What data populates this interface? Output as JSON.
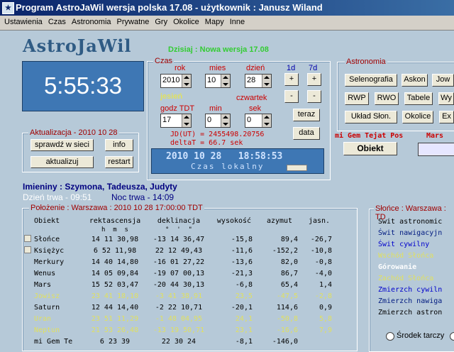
{
  "window": {
    "title": "Program AstroJaWil wersja polska 17.08 - użytkownik : Janusz Wiland",
    "icon": "app-icon"
  },
  "menu": [
    "Ustawienia",
    "Czas",
    "Astronomia",
    "Prywatne",
    "Gry",
    "Okolice",
    "Mapy",
    "Inne"
  ],
  "logo": "AstroJaWil",
  "news": "Dzisiaj : Nowa wersja 17.08",
  "clock": "5:55:33",
  "czas": {
    "label": "Czas",
    "rok_label": "rok",
    "mies_label": "mies",
    "dzien_label": "dzień",
    "d1_label": "1d",
    "d7_label": "7d",
    "rok": "2010",
    "mies": "10",
    "dzien": "28",
    "plus": "+",
    "minus": "-",
    "jesien": "jesień",
    "czwartek": "czwartek",
    "godz_label": "godz TDT",
    "min_label": "min",
    "sek_label": "sek",
    "godz": "17",
    "min": "0",
    "sek": "0",
    "teraz": "teraz",
    "data": "data",
    "jd": "JD(UT) = 2455498.20756",
    "deltat": "deltaT = 66.7 sek",
    "lcd_line1": "2010 10 28   18:58:53",
    "lcd_line2": "Czas lokalny"
  },
  "aktualizacja": {
    "label": "Aktualizacja - 2010 10 28",
    "sprawdz": "sprawdź w sieci",
    "info": "info",
    "aktualizuj": "aktualizuj",
    "restart": "restart"
  },
  "astronomia": {
    "label": "Astronomia",
    "buttons": [
      "Selenografia",
      "Askon",
      "Jow",
      "RWP",
      "RWO",
      "Tabele",
      "Wy",
      "Układ Słon.",
      "Okolice",
      "Ex"
    ]
  },
  "obiekt": {
    "header": "mi Gem Tejat Pos",
    "mars": "Mars",
    "button": "Obiekt"
  },
  "imieniny": "Imieniny : Szymona, Tadeusza, Judyty",
  "dzien_trwa": "Dzień trwa - 09:51",
  "noc_trwa": "Noc trwa - 14:09",
  "polozenie": {
    "label": "Położenie : Warszawa : 2010 10 28  17:00:00 TDT",
    "headers": [
      "Obiekt",
      "rektascensja",
      "deklinacja",
      "wysokość",
      "azymut",
      "jasn."
    ],
    "subheaders": [
      "h",
      "m",
      "s",
      "°",
      "'",
      "\""
    ],
    "rows": [
      {
        "name": "Słońce",
        "ra": "14 11 30,98",
        "dec": "-13 14 36,47",
        "alt": "-15,8",
        "az": "89,4",
        "mag": "-26,7",
        "color": "#000000",
        "check": true
      },
      {
        "name": "Księżyc",
        "ra": "6 52 11,98",
        "dec": "22 12 49,43",
        "alt": "-11,6",
        "az": "-152,2",
        "mag": "-10,8",
        "color": "#000000",
        "check": true
      },
      {
        "name": "Merkury",
        "ra": "14 40 14,80",
        "dec": "-16 01 27,22",
        "alt": "-13,6",
        "az": "82,0",
        "mag": "-0,8",
        "color": "#000000",
        "check": false
      },
      {
        "name": "Wenus",
        "ra": "14 05 09,84",
        "dec": "-19 07 00,13",
        "alt": "-21,3",
        "az": "86,7",
        "mag": "-4,0",
        "color": "#000000",
        "check": false
      },
      {
        "name": "Mars",
        "ra": "15 52 03,47",
        "dec": "-20 44 30,13",
        "alt": "-6,8",
        "az": "65,4",
        "mag": "1,4",
        "color": "#000000",
        "check": false
      },
      {
        "name": "Jowisz",
        "ra": "23 41 18,10",
        "dec": "-3 41 38,91",
        "alt": "23,5",
        "az": "-47,5",
        "mag": "-2,8",
        "color": "#e0e060",
        "check": false
      },
      {
        "name": "Saturn",
        "ra": "12 44 14,40",
        "dec": "-2 22 10,71",
        "alt": "-20,1",
        "az": "114,6",
        "mag": "0,9",
        "color": "#000000",
        "check": false
      },
      {
        "name": "Uran",
        "ra": "23 51 11,29",
        "dec": "-1 48 04,95",
        "alt": "24,1",
        "az": "-50,8",
        "mag": "5,8",
        "color": "#e0e060",
        "check": false
      },
      {
        "name": "Neptun",
        "ra": "21 53 26,48",
        "dec": "-13 19 50,71",
        "alt": "23,1",
        "az": "-16,6",
        "mag": "7,9",
        "color": "#e0e060",
        "check": false
      },
      {
        "name": "mi Gem Te",
        "ra": "6 23 39",
        "dec": "22 30 24",
        "alt": "-8,1",
        "az": "-146,0",
        "mag": "",
        "color": "#000000",
        "check": false
      }
    ]
  },
  "slonce": {
    "label": "Słońce : Warszawa : TD",
    "items": [
      {
        "text": "Świt astronomic",
        "color": "#000000",
        "bold": false
      },
      {
        "text": "Świt nawigacyjn",
        "color": "#001a80",
        "bold": false
      },
      {
        "text": "Świt cywilny",
        "color": "#0000cc",
        "bold": false
      },
      {
        "text": "Wschód Słońca",
        "color": "#e0e060",
        "bold": false
      },
      {
        "text": "Górowanie",
        "color": "#ffffff",
        "bold": true
      },
      {
        "text": "Zachód Słońca",
        "color": "#e0e060",
        "bold": false
      },
      {
        "text": "Zmierzch cywiln",
        "color": "#0000cc",
        "bold": false
      },
      {
        "text": "Zmierzch nawiga",
        "color": "#001a80",
        "bold": false
      },
      {
        "text": "Zmierzch astron",
        "color": "#000000",
        "bold": false
      }
    ],
    "srodek": "Środek tarczy"
  }
}
